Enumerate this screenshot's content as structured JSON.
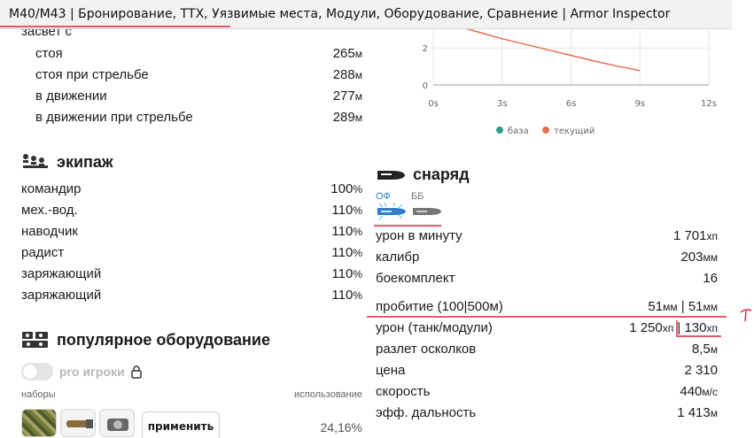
{
  "tooltip": {
    "text": "M40/M43 | Бронирование, ТТХ, Уязвимые места, Модули, Оборудование, Сравнение | Armor Inspector"
  },
  "spotting": {
    "header": "засвет с",
    "rows": [
      {
        "label": "стоя",
        "value": "265",
        "unit": "м"
      },
      {
        "label": "стоя при стрельбе",
        "value": "288",
        "unit": "м"
      },
      {
        "label": "в движении",
        "value": "277",
        "unit": "м"
      },
      {
        "label": "в движении при стрельбе",
        "value": "289",
        "unit": "м"
      }
    ]
  },
  "crew": {
    "title": "экипаж",
    "icon": "crew-icon",
    "rows": [
      {
        "label": "командир",
        "value": "100",
        "unit": "%"
      },
      {
        "label": "мех.-вод.",
        "value": "110",
        "unit": "%"
      },
      {
        "label": "наводчик",
        "value": "110",
        "unit": "%"
      },
      {
        "label": "радист",
        "value": "110",
        "unit": "%"
      },
      {
        "label": "заряжающий",
        "value": "110",
        "unit": "%"
      },
      {
        "label": "заряжающий",
        "value": "110",
        "unit": "%"
      }
    ]
  },
  "equipment": {
    "title": "популярное оборудование",
    "icon": "equipment-icon",
    "pro_label": "pro игроки",
    "pro_enabled": false,
    "col_sets": "наборы",
    "col_usage": "использование",
    "apply_label": "применить",
    "usage_value": "24,16%",
    "items": [
      "camouflage-net-icon",
      "rammer-icon",
      "vent-icon"
    ]
  },
  "chart_data": {
    "type": "line",
    "x": [
      0,
      1,
      2,
      3,
      4,
      5,
      6,
      7,
      8,
      9
    ],
    "xticks": [
      "0s",
      "3s",
      "6s",
      "9s",
      "12s"
    ],
    "xlim": [
      0,
      12
    ],
    "yticks": [
      "0",
      "2"
    ],
    "ylim": [
      0,
      3.4
    ],
    "series": [
      {
        "name": "база",
        "color": "#2a9d8f",
        "values": []
      },
      {
        "name": "текущий",
        "color": "#e76f51",
        "values": [
          3.6,
          3.2,
          2.85,
          2.5,
          2.2,
          1.9,
          1.6,
          1.3,
          1.02,
          0.78
        ]
      }
    ],
    "legend": "bottom"
  },
  "shell": {
    "title": "снаряд",
    "icon": "shell-icon",
    "tabs": [
      {
        "label": "ОФ",
        "active": true,
        "icon": "he-shell-icon"
      },
      {
        "label": "ББ",
        "active": false,
        "icon": "ap-shell-icon"
      }
    ],
    "rows": [
      {
        "label": "урон в минуту",
        "value": "1 701",
        "unit": "хп"
      },
      {
        "label": "калибр",
        "value": "203",
        "unit": "мм"
      },
      {
        "label": "боекомплект",
        "value": "16",
        "unit": ""
      }
    ],
    "pen": {
      "label": "пробитие (100|500м)",
      "v1": "51",
      "u1": "мм",
      "sep": " | ",
      "v2": "51",
      "u2": "мм"
    },
    "damage": {
      "label": "урон (танк/модули)",
      "v1": "1 250",
      "u1": "хп",
      "sep": " | ",
      "v2": "130",
      "u2": "хп"
    },
    "rows2": [
      {
        "label": "разлет осколков",
        "value": "8,5",
        "unit": "м"
      },
      {
        "label": "цена",
        "value": "2 310",
        "unit": ""
      },
      {
        "label": "скорость",
        "value": "440",
        "unit": "м/с"
      },
      {
        "label": "эфф. дальность",
        "value": "1 413",
        "unit": "м"
      }
    ]
  },
  "colors": {
    "accent": "#2f80c8",
    "annotation": "#d7263d",
    "base": "#2a9d8f",
    "current": "#e76f51"
  }
}
